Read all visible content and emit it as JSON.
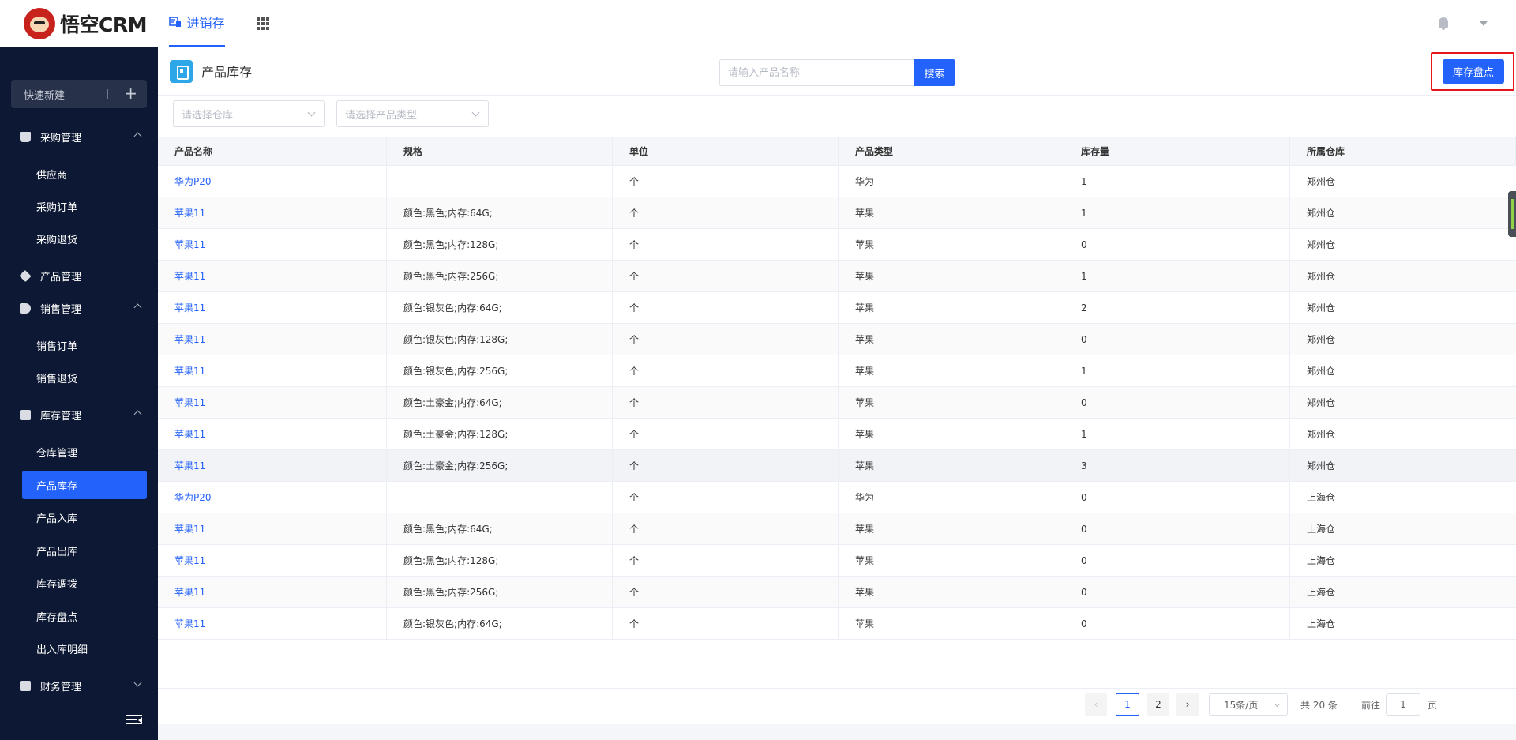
{
  "app": {
    "logo_text": "悟空CRM"
  },
  "topnav": {
    "active_tab": "进销存"
  },
  "sidebar": {
    "quick_new": "快速新建",
    "groups": [
      {
        "label": "采购管理",
        "items": [
          "供应商",
          "采购订单",
          "采购退货"
        ]
      },
      {
        "label": "产品管理",
        "items": []
      },
      {
        "label": "销售管理",
        "items": [
          "销售订单",
          "销售退货"
        ]
      },
      {
        "label": "库存管理",
        "items": [
          "仓库管理",
          "产品库存",
          "产品入库",
          "产品出库",
          "库存调拨",
          "库存盘点",
          "出入库明细"
        ]
      },
      {
        "label": "财务管理",
        "items": []
      }
    ]
  },
  "header": {
    "title": "产品库存",
    "search_placeholder": "请输入产品名称",
    "search_button": "搜索",
    "stock_check_button": "库存盘点"
  },
  "filters": {
    "warehouse_placeholder": "请选择仓库",
    "type_placeholder": "请选择产品类型"
  },
  "table": {
    "columns": [
      "产品名称",
      "规格",
      "单位",
      "产品类型",
      "库存量",
      "所属仓库"
    ],
    "rows": [
      [
        "华为P20",
        "--",
        "个",
        "华为",
        "1",
        "郑州仓"
      ],
      [
        "苹果11",
        "颜色:黑色;内存:64G;",
        "个",
        "苹果",
        "1",
        "郑州仓"
      ],
      [
        "苹果11",
        "颜色:黑色;内存:128G;",
        "个",
        "苹果",
        "0",
        "郑州仓"
      ],
      [
        "苹果11",
        "颜色:黑色;内存:256G;",
        "个",
        "苹果",
        "1",
        "郑州仓"
      ],
      [
        "苹果11",
        "颜色:银灰色;内存:64G;",
        "个",
        "苹果",
        "2",
        "郑州仓"
      ],
      [
        "苹果11",
        "颜色:银灰色;内存:128G;",
        "个",
        "苹果",
        "0",
        "郑州仓"
      ],
      [
        "苹果11",
        "颜色:银灰色;内存:256G;",
        "个",
        "苹果",
        "1",
        "郑州仓"
      ],
      [
        "苹果11",
        "颜色:土豪金;内存:64G;",
        "个",
        "苹果",
        "0",
        "郑州仓"
      ],
      [
        "苹果11",
        "颜色:土豪金;内存:128G;",
        "个",
        "苹果",
        "1",
        "郑州仓"
      ],
      [
        "苹果11",
        "颜色:土豪金;内存:256G;",
        "个",
        "苹果",
        "3",
        "郑州仓"
      ],
      [
        "华为P20",
        "--",
        "个",
        "华为",
        "0",
        "上海仓"
      ],
      [
        "苹果11",
        "颜色:黑色;内存:64G;",
        "个",
        "苹果",
        "0",
        "上海仓"
      ],
      [
        "苹果11",
        "颜色:黑色;内存:128G;",
        "个",
        "苹果",
        "0",
        "上海仓"
      ],
      [
        "苹果11",
        "颜色:黑色;内存:256G;",
        "个",
        "苹果",
        "0",
        "上海仓"
      ],
      [
        "苹果11",
        "颜色:银灰色;内存:64G;",
        "个",
        "苹果",
        "0",
        "上海仓"
      ]
    ]
  },
  "pagination": {
    "pages": [
      "1",
      "2"
    ],
    "current": "1",
    "page_size": "15条/页",
    "total": "共 20 条",
    "goto_label": "前往",
    "goto_value": "1",
    "goto_unit": "页"
  },
  "colors": {
    "accent": "#2362fb",
    "sidebar_bg": "#0d1934",
    "highlight": "#e8161a"
  },
  "icons": {
    "topnav": [
      "invoice-icon",
      "apps-grid-icon",
      "bell-icon",
      "chevron-down-icon"
    ],
    "sidebar": [
      "cart-icon",
      "cube-icon",
      "tag-icon",
      "archive-icon",
      "wallet-icon",
      "menu-collapse-icon"
    ]
  }
}
